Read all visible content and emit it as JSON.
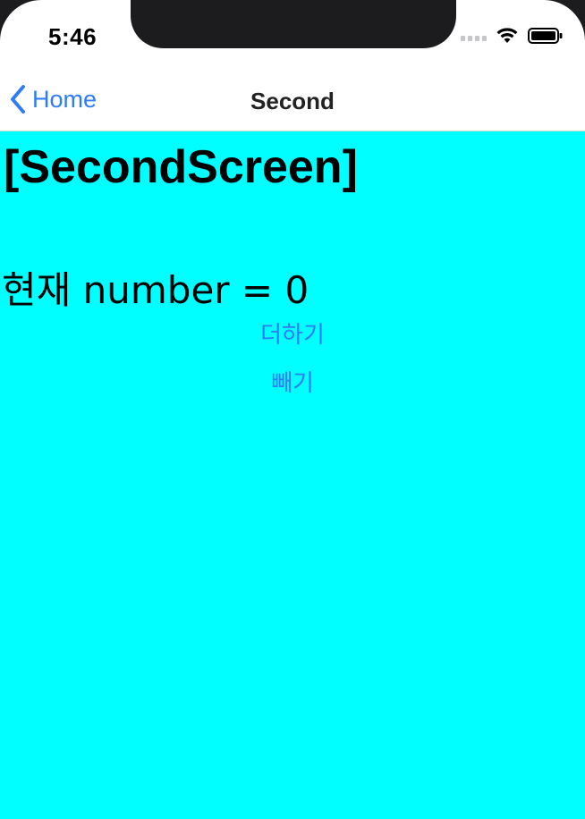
{
  "status_bar": {
    "time": "5:46",
    "icons": [
      "cellular-signal-icon",
      "wifi-icon",
      "battery-icon"
    ]
  },
  "nav": {
    "back_label": "Home",
    "title": "Second"
  },
  "content": {
    "screen_title": "[SecondScreen]",
    "number_text": "현재 number = 0",
    "buttons": {
      "add_label": "더하기",
      "subtract_label": "빼기"
    }
  },
  "colors": {
    "content_background": "#00ffff",
    "accent": "#2f7cf6"
  }
}
